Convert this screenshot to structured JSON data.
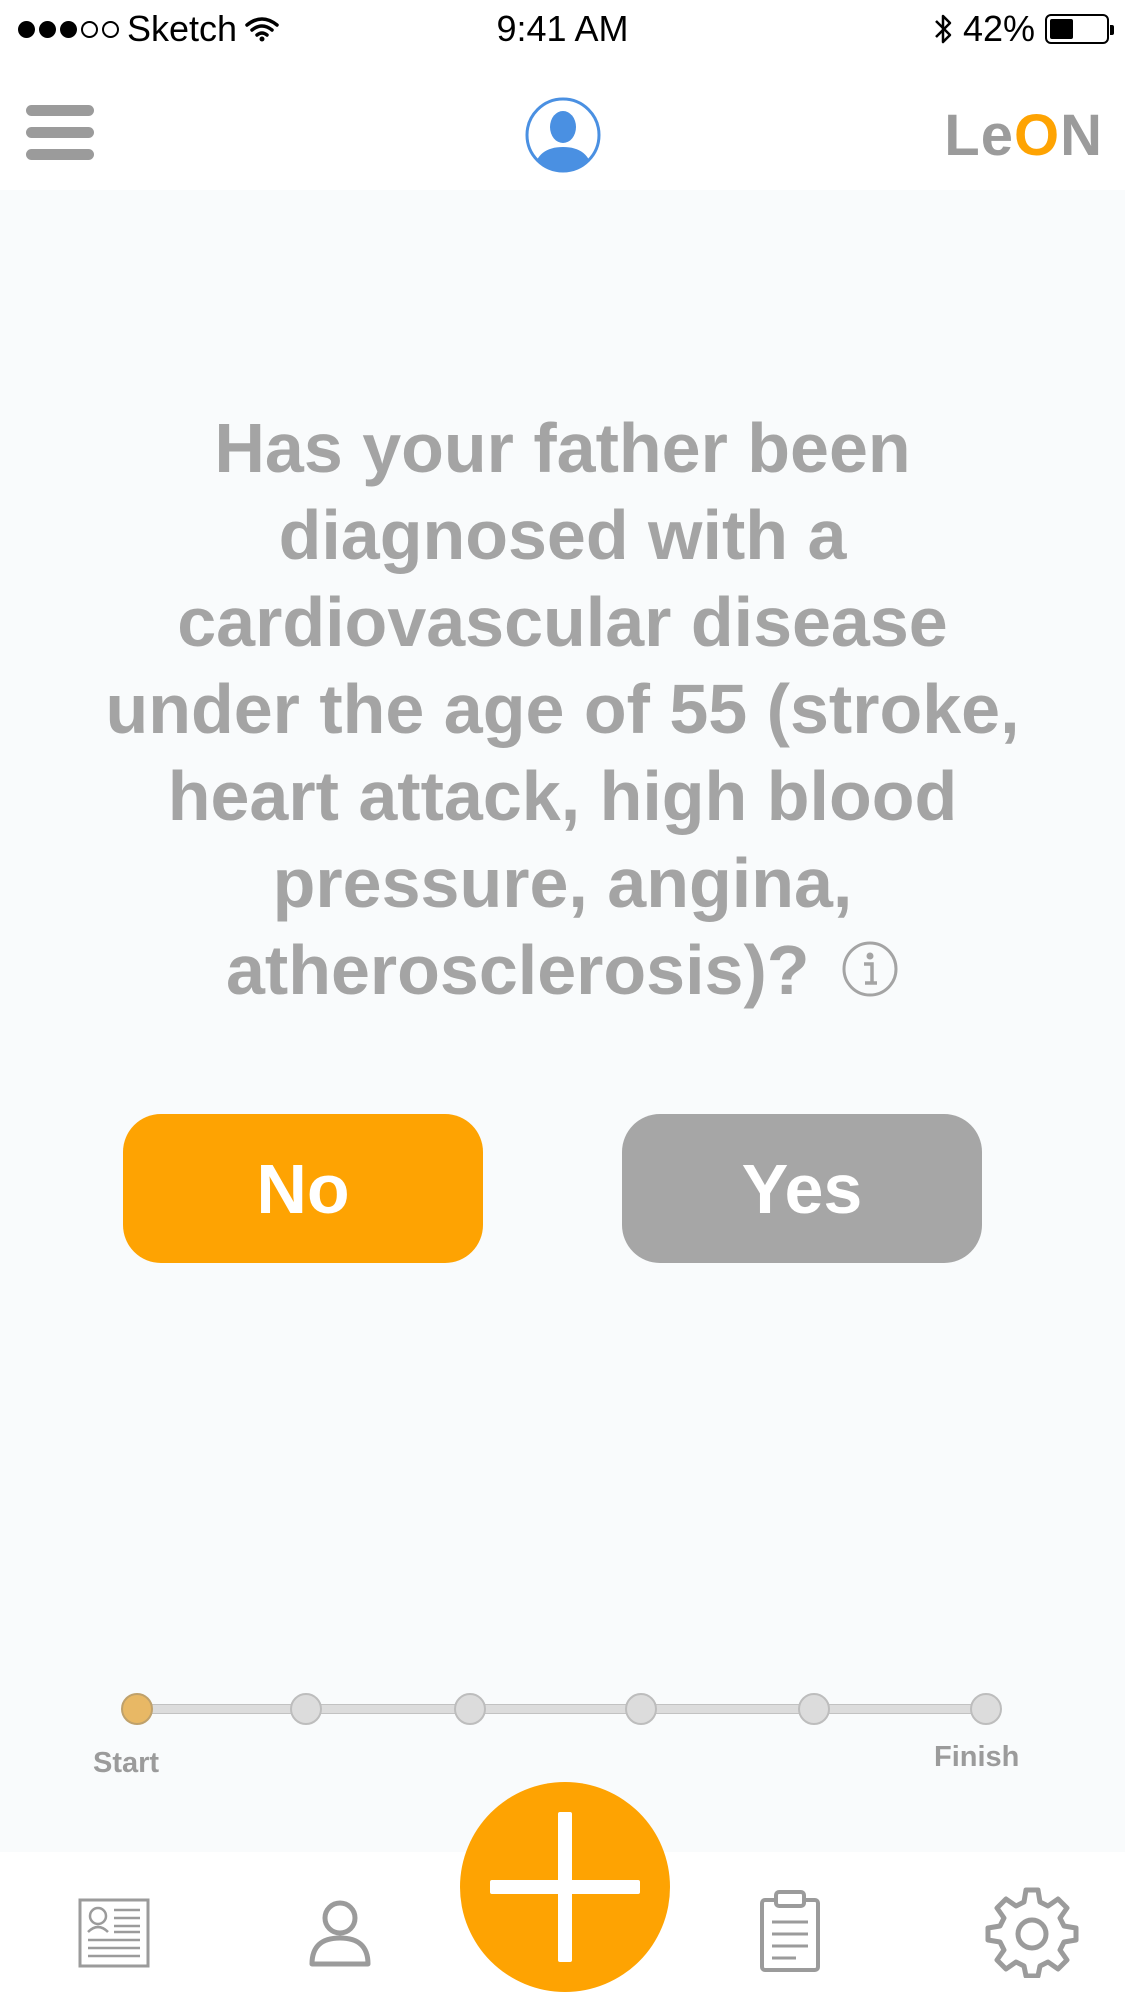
{
  "status_bar": {
    "carrier": "Sketch",
    "time": "9:41 AM",
    "battery_percent": "42%",
    "battery_level": 0.42,
    "signal_bars_filled": 3,
    "signal_bars_total": 5,
    "icons": [
      "wifi-icon",
      "bluetooth-icon",
      "battery-icon"
    ]
  },
  "header": {
    "logo_prefix": "Le",
    "logo_accent": "O",
    "logo_suffix": "N",
    "icons": [
      "menu-icon",
      "user-avatar-icon"
    ]
  },
  "question": {
    "text": "Has your father been diagnosed with a cardiovascular disease under the age of 55 (stroke, heart attack, high blood pressure, angina, atherosclerosis)?",
    "info_icon": "info-icon"
  },
  "answers": {
    "no_label": "No",
    "yes_label": "Yes"
  },
  "progress": {
    "start_label": "Start",
    "finish_label": "Finish",
    "total_steps": 6,
    "current_step": 1
  },
  "tab_bar": {
    "icons": [
      "news-icon",
      "profile-icon",
      "add-icon",
      "clipboard-icon",
      "settings-icon"
    ]
  },
  "colors": {
    "accent": "#fea302",
    "muted_button": "#a6a6a6",
    "text_gray": "#a4a4a4",
    "avatar_blue": "#4a90e2",
    "background": "#f9fbfc"
  }
}
